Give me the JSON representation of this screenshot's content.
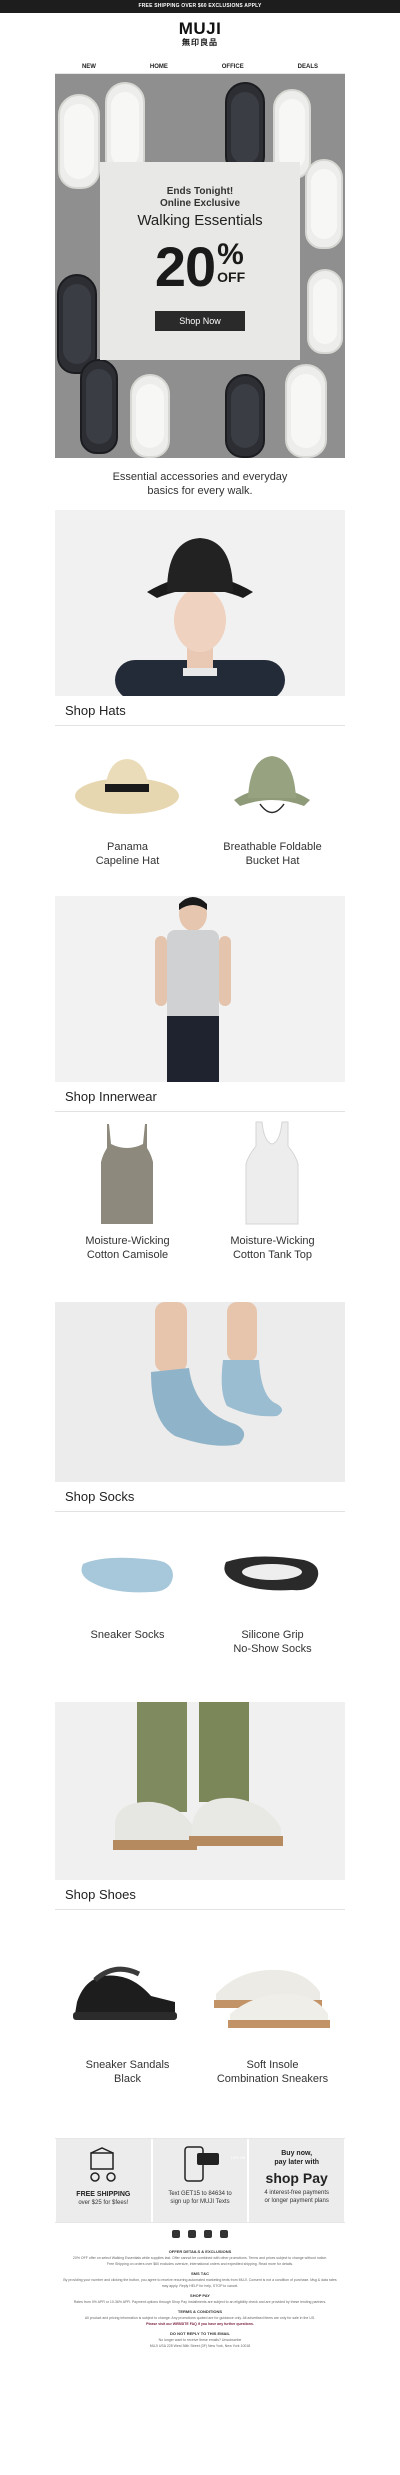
{
  "topbar": {
    "text": "FREE SHIPPING OVER $60 EXCLUSIONS APPLY"
  },
  "brand": {
    "name": "MUJI",
    "jp": "無印良品"
  },
  "nav": [
    "NEW",
    "HOME",
    "OFFICE",
    "DEALS"
  ],
  "hero": {
    "kicker_1": "Ends Tonight!",
    "kicker_2": "Online Exclusive",
    "title": "Walking Essentials",
    "percent": "20",
    "percent_sign": "%",
    "off": "OFF",
    "cta": "Shop Now"
  },
  "intro": {
    "line1": "Essential accessories and everyday",
    "line2": "basics for every walk."
  },
  "sections": [
    {
      "title": "Shop Hats",
      "products": [
        {
          "l1": "Panama",
          "l2": "Capeline Hat"
        },
        {
          "l1": "Breathable Foldable",
          "l2": "Bucket Hat"
        }
      ]
    },
    {
      "title": "Shop Innerwear",
      "products": [
        {
          "l1": "Moisture-Wicking",
          "l2": "Cotton Camisole"
        },
        {
          "l1": "Moisture-Wicking",
          "l2": "Cotton Tank Top"
        }
      ]
    },
    {
      "title": "Shop Socks",
      "products": [
        {
          "l1": "Sneaker Socks",
          "l2": ""
        },
        {
          "l1": "Silicone Grip",
          "l2": "No-Show Socks"
        }
      ]
    },
    {
      "title": "Shop Shoes",
      "products": [
        {
          "l1": "Sneaker Sandals",
          "l2": "Black"
        },
        {
          "l1": "Soft Insole",
          "l2": "Combination Sneakers"
        }
      ]
    }
  ],
  "features": {
    "shipping_title": "FREE SHIPPING",
    "shipping_text": "over $25 for $fees!",
    "text_badge": "15% Off",
    "text_line1": "Text GET15 to 84634 to",
    "text_line2": "sign up for MUJI Texts",
    "pay_title_1": "Buy now,",
    "pay_title_2": "pay later with",
    "pay_brand": "shop Pay",
    "pay_text_1": "4 interest-free payments",
    "pay_text_2": "or longer payment plans"
  },
  "social": [
    "facebook-icon",
    "instagram-icon",
    "tiktok-icon",
    "x-icon"
  ],
  "fine": {
    "h1": "OFFER DETAILS & EXCLUSIONS",
    "p1": "20% OFF offer on select Walking Essentials while supplies last. Offer cannot be combined with other promotions. Terms and prices subject to change without notice.",
    "p2": "Free Shipping on orders over $60 excludes oversize, international orders and expedited shipping. Read more for details.",
    "h2": "SMS T&C",
    "p3": "By providing your number and clicking the button, you agree to receive recurring automated marketing texts from MUJI. Consent is not a condition of purchase. Msg & data rates may apply. Reply HELP for help, STOP to cancel.",
    "h3": "SHOP PAY",
    "p4": "Rates from 0% APR or 10-36% APR. Payment options through Shop Pay Installments are subject to an eligibility check and are provided by these lending partners.",
    "h4": "TERMS & CONDITIONS",
    "p5": "All product and pricing information is subject to change. Any promotions quoted are for guidance only. All advertised items are only for sale in the US.",
    "p6": "Please visit our WEBSITE FAQ if you have any further questions.",
    "h5": "DO NOT REPLY TO THIS EMAIL",
    "p7": "No longer want to receive these emails? Unsubscribe",
    "p8": "MUJI USA 228 West 36th Street (3F) New York, New York 10018"
  },
  "colors": {
    "topbar": "#1d1d1d",
    "hero_card": "#e8e8e6",
    "button": "#2a2a2a",
    "link": "#7a1f3d"
  }
}
